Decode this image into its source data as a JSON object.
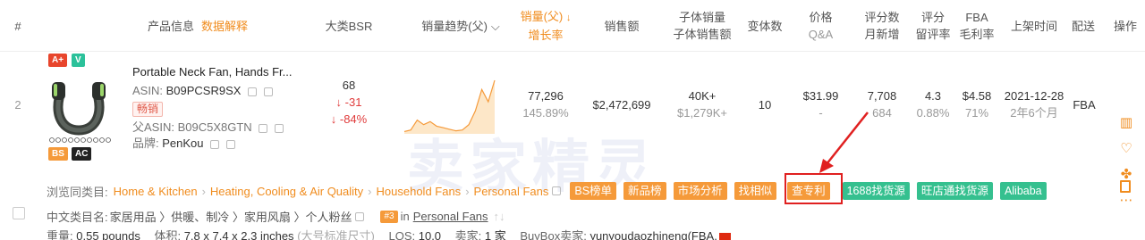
{
  "header": {
    "index": "#",
    "product_info": "产品信息",
    "data_explain": "数据解释",
    "category_bsr": "大类BSR",
    "sales_trend": "销量趋势(父)",
    "sales_parent": "销量(父)",
    "growth_rate": "增长率",
    "revenue": "销售额",
    "child_sales": "子体销量",
    "child_revenue": "子体销售额",
    "variants": "变体数",
    "price": "价格",
    "qa": "Q&A",
    "reviews": "评分数",
    "monthly_new": "月新增",
    "rating": "评分",
    "retention": "留评率",
    "fba": "FBA",
    "margin": "毛利率",
    "listed_time": "上架时间",
    "shipping": "配送",
    "actions": "操作"
  },
  "product": {
    "index": "2",
    "badge_a": "A+",
    "badge_v": "V",
    "badge_bs": "BS",
    "badge_ac": "AC",
    "title": "Portable Neck Fan, Hands Fr...",
    "asin_label": "ASIN:",
    "asin": "B09PCSR9SX",
    "hot_tag": "畅销",
    "parent_asin_label": "父ASIN:",
    "parent_asin": "B09C5X8GTN",
    "brand_label": "品牌:",
    "brand": "PenKou",
    "bsr": "68",
    "bsr_change": "↓ -31",
    "bsr_pct": "↓ -84%",
    "sales": "77,296",
    "growth": "145.89%",
    "revenue": "$2,472,699",
    "child_sales": "40K+",
    "child_revenue": "$1,279K+",
    "variants": "10",
    "price": "$31.99",
    "qa": "-",
    "reviews": "7,708",
    "monthly_new": "684",
    "rating": "4.3",
    "retention": "0.88%",
    "fba": "$4.58",
    "margin": "71%",
    "listed_date": "2021-12-28",
    "listed_ago": "2年6个月",
    "shipping": "FBA"
  },
  "trend": [
    3,
    5,
    18,
    12,
    16,
    10,
    8,
    6,
    4,
    5,
    12,
    30,
    58,
    42,
    70
  ],
  "category": {
    "label": "浏览同类目:",
    "crumbs": [
      "Home & Kitchen",
      "Heating, Cooling & Air Quality",
      "Household Fans",
      "Personal Fans"
    ],
    "buttons": [
      "BS榜单",
      "新品榜",
      "市场分析",
      "找相似",
      "查专利"
    ],
    "green_buttons": [
      "1688找货源",
      "旺店通找货源",
      "Alibaba"
    ]
  },
  "cn_category": {
    "label": "中文类目名:",
    "path": "家居用品 〉供暖、制冷 〉家用风扇 〉个人粉丝",
    "rank": "#3",
    "in": "in",
    "rank_cat": "Personal Fans"
  },
  "meta": {
    "weight_label": "重量:",
    "weight": "0.55 pounds",
    "size_label": "体积:",
    "size": "7.8 x 7.4 x 2.3 inches",
    "size_note": "(大号标准尺寸)",
    "lqs_label": "LQS:",
    "lqs": "10.0",
    "sellers_label": "卖家:",
    "sellers": "1 家",
    "buybox_label": "BuyBox卖家:",
    "buybox": "yunyoudaozhineng(FBA,"
  },
  "colors": {
    "accent": "#f08c1e",
    "green": "#35c08f",
    "red_box": "#e02020"
  }
}
